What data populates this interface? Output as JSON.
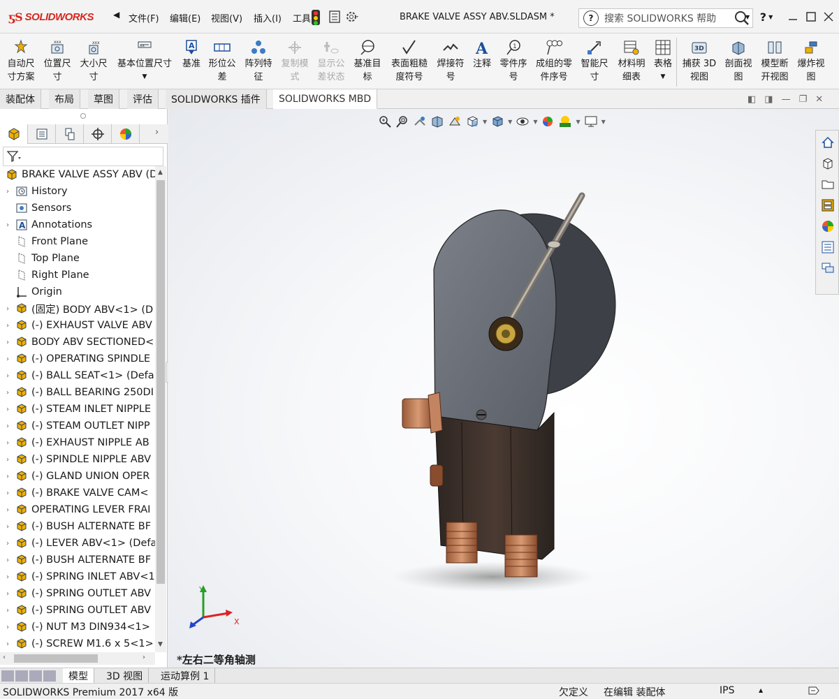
{
  "app": {
    "logo_text": "SOLIDWORKS",
    "document_title": "BRAKE VALVE ASSY ABV.SLDASM *"
  },
  "menu": {
    "items": [
      "文件(F)",
      "编辑(E)",
      "视图(V)",
      "插入(I)",
      "工具"
    ]
  },
  "search": {
    "placeholder": "搜索 SOLIDWORKS 帮助"
  },
  "window_controls": {
    "help": "?"
  },
  "ribbon": {
    "buttons": [
      {
        "l1": "自动尺",
        "l2": "寸方案"
      },
      {
        "l1": "位置尺",
        "l2": "寸"
      },
      {
        "l1": "大小尺",
        "l2": "寸"
      },
      {
        "l1": "基本位置尺寸",
        "l2": ""
      },
      {
        "l1": "基准",
        "l2": ""
      },
      {
        "l1": "形位公",
        "l2": "差"
      },
      {
        "l1": "阵列特",
        "l2": "征"
      },
      {
        "l1": "复制模",
        "l2": "式"
      },
      {
        "l1": "显示公",
        "l2": "差状态"
      },
      {
        "l1": "基准目",
        "l2": "标"
      },
      {
        "l1": "表面粗糙",
        "l2": "度符号"
      },
      {
        "l1": "焊接符",
        "l2": "号"
      },
      {
        "l1": "注释",
        "l2": ""
      },
      {
        "l1": "零件序",
        "l2": "号"
      },
      {
        "l1": "成组的零",
        "l2": "件序号"
      },
      {
        "l1": "智能尺",
        "l2": "寸"
      },
      {
        "l1": "材料明",
        "l2": "细表"
      },
      {
        "l1": "表格",
        "l2": ""
      },
      {
        "l1": "捕获 3D",
        "l2": "视图"
      },
      {
        "l1": "剖面视",
        "l2": "图"
      },
      {
        "l1": "模型断",
        "l2": "开视图"
      },
      {
        "l1": "爆炸视",
        "l2": "图"
      }
    ]
  },
  "tabs": [
    "装配体",
    "布局",
    "草图",
    "评估",
    "SOLIDWORKS 插件",
    "SOLIDWORKS MBD"
  ],
  "active_tab": "SOLIDWORKS MBD",
  "tree": {
    "root": "BRAKE VALVE ASSY ABV  (D",
    "items": [
      "History",
      "Sensors",
      "Annotations",
      "Front Plane",
      "Top Plane",
      "Right Plane",
      "Origin",
      "(固定) BODY ABV<1> (D",
      "(-) EXHAUST VALVE ABV",
      "BODY ABV SECTIONED<",
      "(-) OPERATING SPINDLE",
      "(-) BALL SEAT<1> (Defa",
      "(-) BALL BEARING 250DI",
      "(-) STEAM INLET NIPPLE",
      "(-) STEAM OUTLET NIPP",
      "(-) EXHAUST NIPPLE AB",
      "(-) SPINDLE NIPPLE ABV",
      "(-) GLAND UNION OPER",
      "(-) BRAKE VALVE CAM<",
      "OPERATING LEVER FRAI",
      "(-) BUSH ALTERNATE BF",
      "(-) LEVER ABV<1> (Defa",
      "(-) BUSH ALTERNATE BF",
      "(-) SPRING INLET ABV<1",
      "(-) SPRING OUTLET ABV",
      "(-) SPRING OUTLET ABV",
      "(-) NUT M3 DIN934<1>",
      "(-) SCREW M1.6 x 5<1>"
    ]
  },
  "viewport": {
    "view_name": "*左右二等角轴测",
    "triad": {
      "x": "X",
      "y": "Y"
    }
  },
  "bottom_tabs": [
    "模型",
    "3D 视图",
    "运动算例 1"
  ],
  "active_bottom_tab": "模型",
  "status": {
    "product": "SOLIDWORKS Premium 2017 x64 版",
    "definition": "欠定义",
    "mode": "在编辑 装配体",
    "units": "IPS"
  }
}
